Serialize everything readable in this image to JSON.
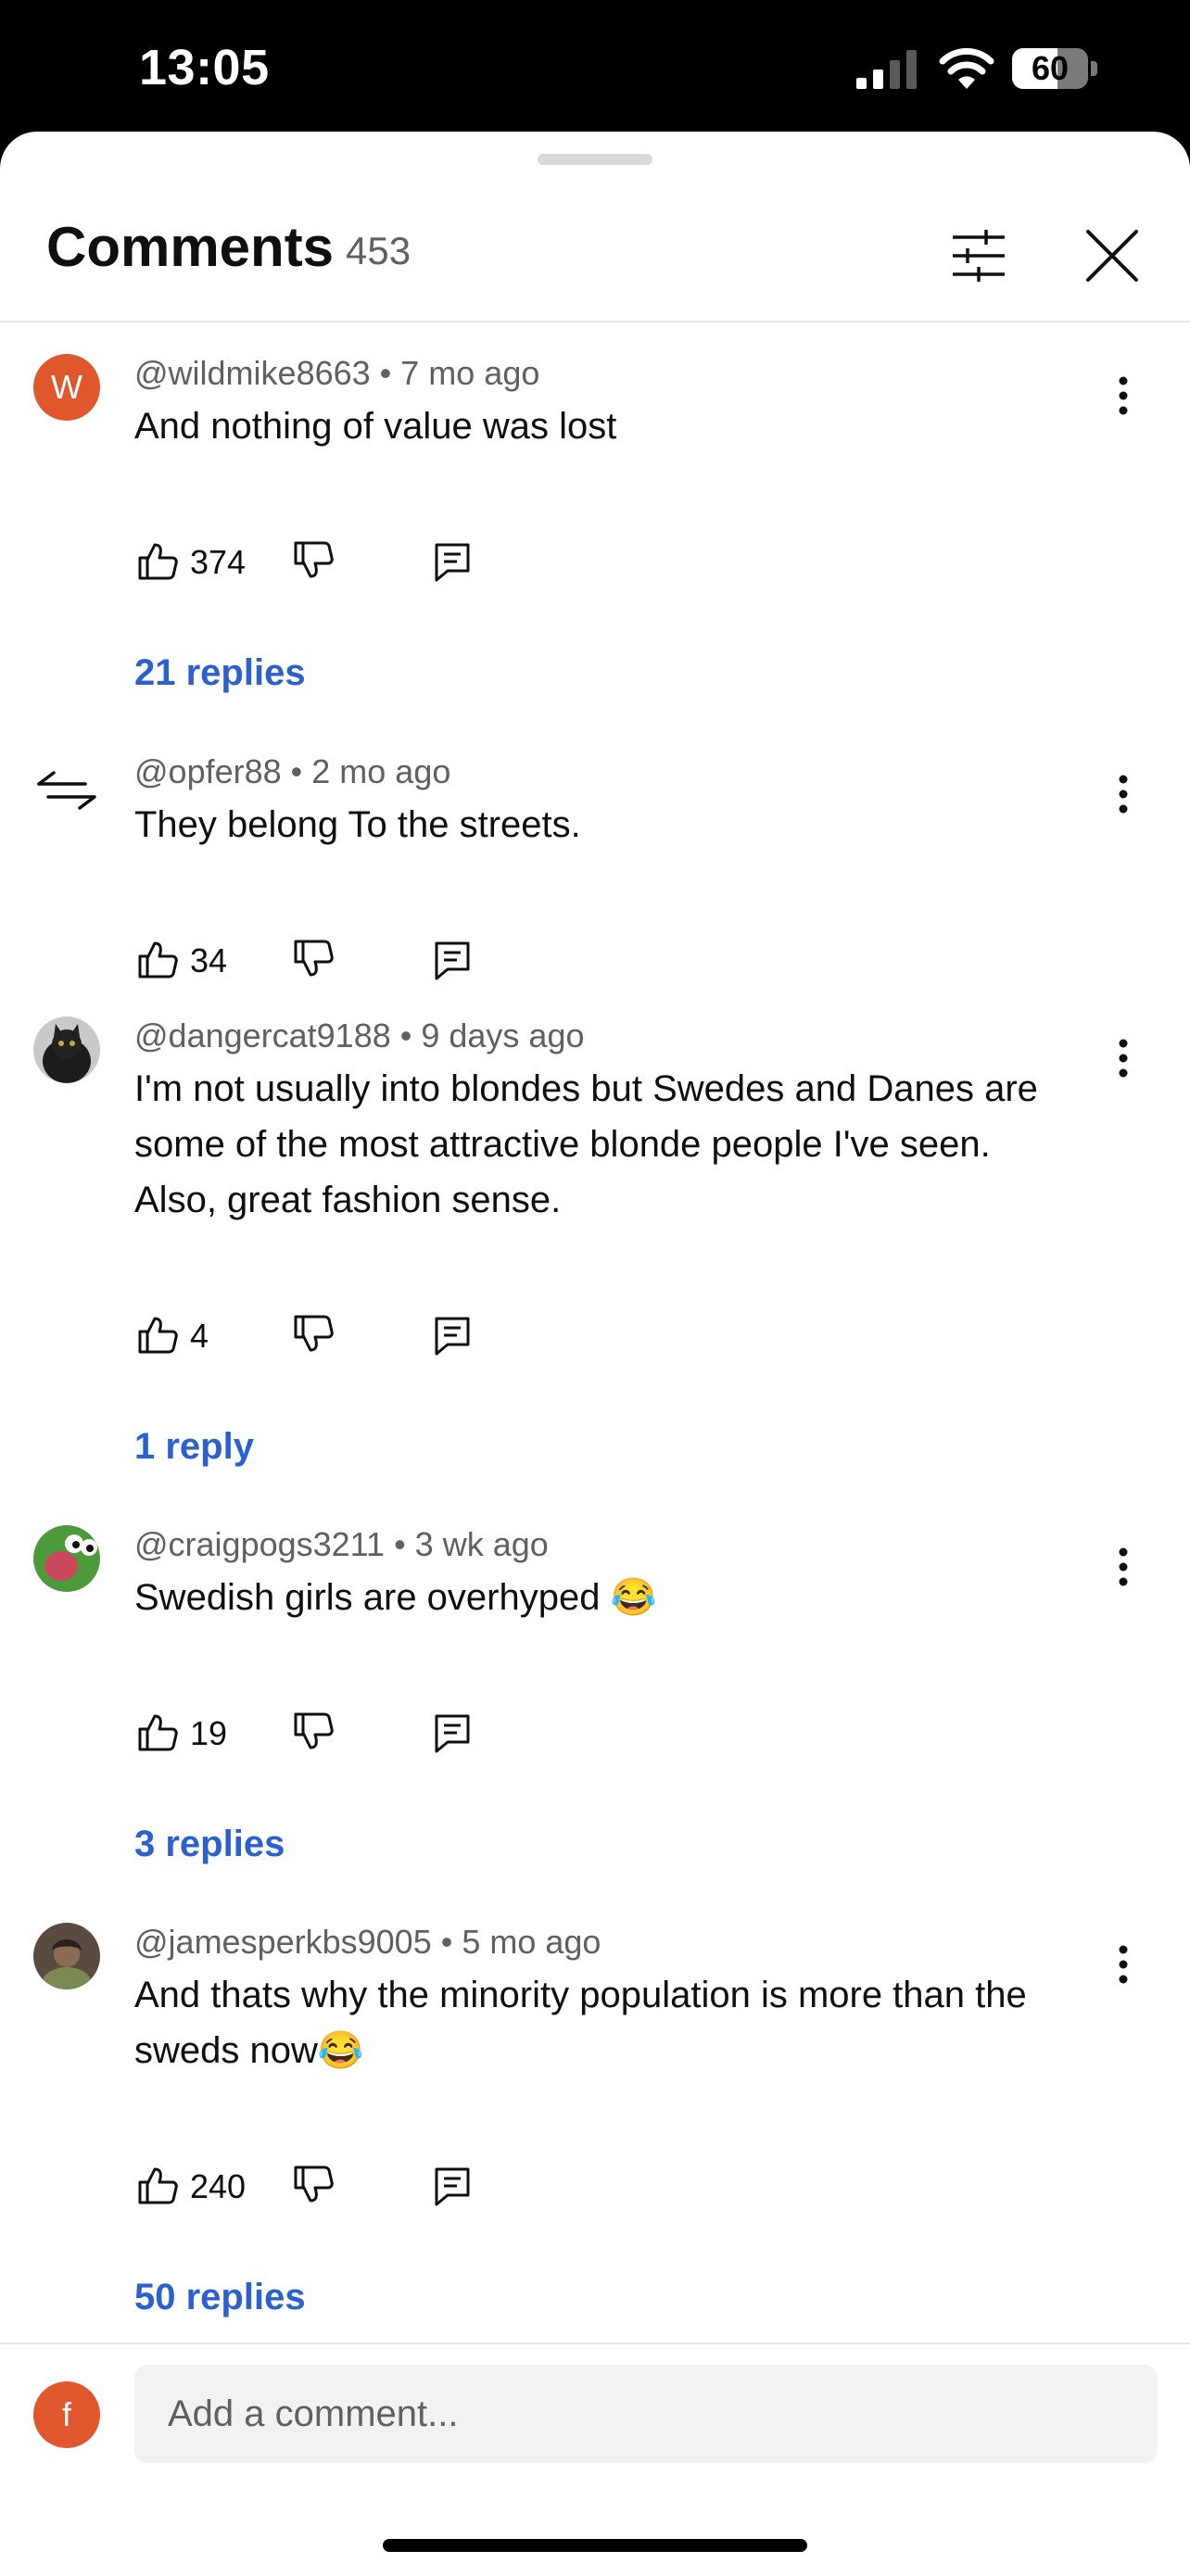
{
  "status_bar": {
    "time": "13:05",
    "battery_level": "60",
    "battery_percent": 60
  },
  "header": {
    "title": "Comments",
    "count": "453"
  },
  "comments": [
    {
      "author": "@wildmike8663",
      "age": "7 mo ago",
      "text": "And nothing of value was lost",
      "likes": "374",
      "replies": "21 replies",
      "avatar_letter": "W",
      "avatar_color": "#e0562d"
    },
    {
      "author": "@opfer88",
      "age": "2 mo ago",
      "text": "They belong To the streets.",
      "likes": "34",
      "replies": ""
    },
    {
      "author": "@dangercat9188",
      "age": "9 days ago",
      "text": "I'm not usually into blondes but Swedes and Danes are some of the most attractive blonde people I've seen. Also, great fashion sense.",
      "likes": "4",
      "replies": "1 reply"
    },
    {
      "author": "@craigpogs3211",
      "age": "3 wk ago",
      "text": "Swedish girls are overhyped 😂",
      "likes": "19",
      "replies": "3 replies"
    },
    {
      "author": "@jamesperkbs9005",
      "age": "5 mo ago",
      "text": "And thats why the minority  population is more than the sweds now😂",
      "likes": "240",
      "replies": "50 replies"
    }
  ],
  "composer": {
    "avatar_letter": "f",
    "placeholder": "Add a comment..."
  },
  "colors": {
    "accent": "#2a60cf",
    "avatar_orange": "#e0562d",
    "meta_text": "#606060"
  },
  "icons": [
    "thumbs-up-icon",
    "thumbs-down-icon",
    "reply-icon",
    "more-vertical-icon",
    "filter-icon",
    "close-icon"
  ]
}
